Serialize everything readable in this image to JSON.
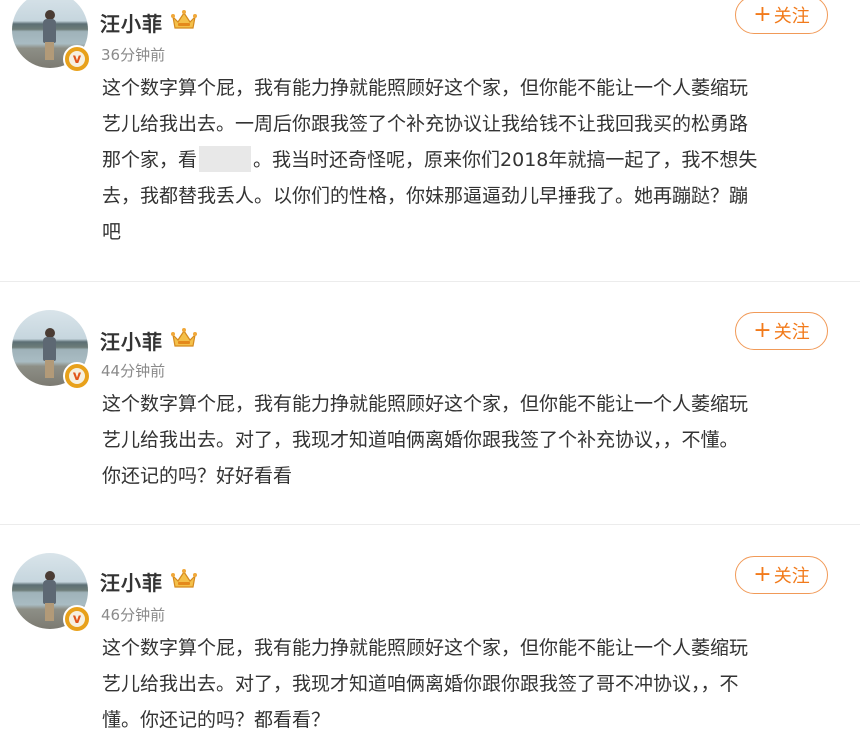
{
  "posts": [
    {
      "username": "汪小菲",
      "time": "36分钟前",
      "follow_label": "关注",
      "content_lines": [
        "这个数字算个屁，我有能力挣就能照顾好这个家，但你能不能让一个人萎缩玩",
        "艺儿给我出去。一周后你跟我签了个补充协议让我给钱不让我回我买的松勇路",
        "那个家，看",
        "。我当时还奇怪呢，原来你们2018年就搞一起了，我不想失",
        "去，我都替我丢人。以你们的性格，你妹那逼逼劲儿早捶我了。她再蹦跶？蹦",
        "吧"
      ]
    },
    {
      "username": "汪小菲",
      "time": "44分钟前",
      "follow_label": "关注",
      "content_lines": [
        "这个数字算个屁，我有能力挣就能照顾好这个家，但你能不能让一个人萎缩玩",
        "艺儿给我出去。对了，我现才知道咱俩离婚你跟我签了个补充协议，，不懂。",
        "你还记的吗？好好看看"
      ]
    },
    {
      "username": "汪小菲",
      "time": "46分钟前",
      "follow_label": "关注",
      "content_lines": [
        "这个数字算个屁，我有能力挣就能照顾好这个家，但你能不能让一个人萎缩玩",
        "艺儿给我出去。对了，我现才知道咱俩离婚你跟你跟我签了哥不冲协议，，不",
        "懂。你还记的吗？都看看？"
      ]
    }
  ],
  "colors": {
    "accent": "#f27a1a",
    "follow_border": "#f19a58",
    "verified_badge": "#e8a11b",
    "text": "#333333",
    "meta": "#8a8a8a",
    "divider": "#ececec"
  },
  "icons": {
    "verified": "verified-v-badge-icon",
    "crown": "crown-vip-icon",
    "plus": "plus-icon"
  }
}
